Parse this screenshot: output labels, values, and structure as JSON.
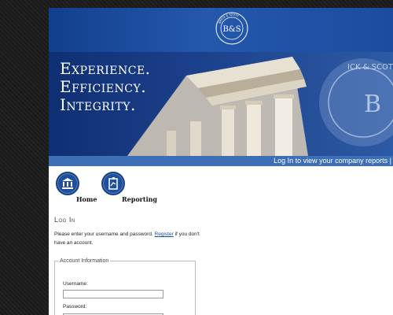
{
  "brand": {
    "logo_initials": "B&S",
    "logo_ring_text": "BRICK & SCOTT",
    "seal_text": "ICK & SCOTT"
  },
  "hero": {
    "tagline": [
      "Experience.",
      "Efficiency.",
      "Integrity."
    ]
  },
  "strip": {
    "text": "Log In to view your company reports |"
  },
  "nav": {
    "items": [
      {
        "label": "Home",
        "icon": "bank-building-icon"
      },
      {
        "label": "Reporting",
        "icon": "report-document-icon"
      }
    ]
  },
  "login": {
    "title": "Log In",
    "intro_before": "Please enter your username and password. ",
    "register_link": "Register",
    "intro_after": " if you don't have an account.",
    "fieldset_legend": "Account Information",
    "username_label": "Username:",
    "username_value": "",
    "password_label": "Password:",
    "password_value": ""
  },
  "colors": {
    "brand_blue": "#1f4f9a",
    "strip_blue": "#3d6fb6",
    "hero_navy": "#0f2f73"
  }
}
